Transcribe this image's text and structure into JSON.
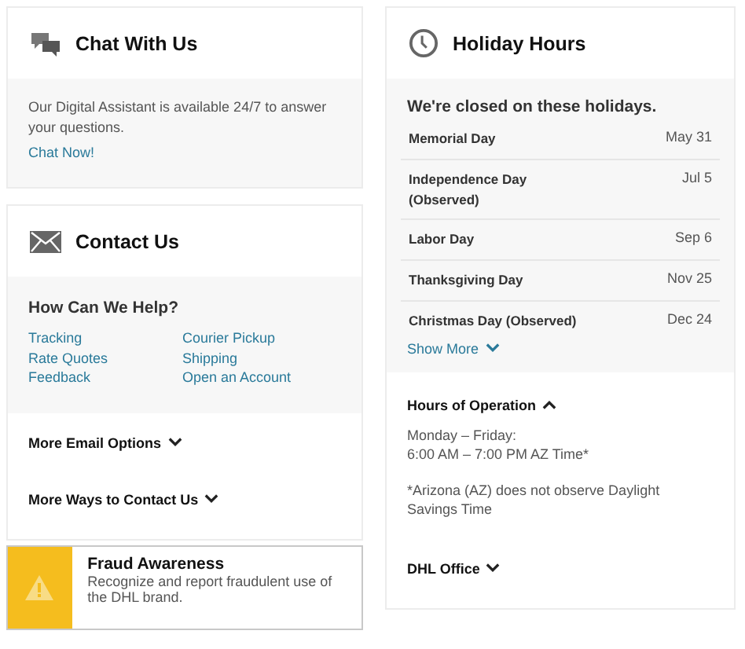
{
  "chat": {
    "title": "Chat With Us",
    "text": "Our Digital Assistant is available 24/7 to answer your questions.",
    "link": "Chat Now!"
  },
  "contact": {
    "title": "Contact Us",
    "subtitle": "How Can We Help?",
    "links": [
      "Tracking",
      "Courier Pickup",
      "Rate Quotes",
      "Shipping",
      "Feedback",
      "Open an Account"
    ],
    "expanders": [
      {
        "label": "More Email Options",
        "expanded": false
      },
      {
        "label": "More Ways to Contact Us",
        "expanded": false
      }
    ]
  },
  "fraud": {
    "title": "Fraud Awareness",
    "text": "Recognize and report fraudulent use of the DHL brand."
  },
  "holiday": {
    "title": "Holiday Hours",
    "subtitle": "We're closed on these holidays.",
    "rows": [
      {
        "name": "Memorial Day",
        "date": "May 31"
      },
      {
        "name": "Independence Day (Observed)",
        "date": "Jul 5"
      },
      {
        "name": "Labor Day",
        "date": "Sep 6"
      },
      {
        "name": "Thanksgiving Day",
        "date": "Nov 25"
      },
      {
        "name": "Christmas Day (Observed)",
        "date": "Dec 24"
      }
    ],
    "show_more": {
      "label": "Show More",
      "expanded": false
    },
    "hours": {
      "label": "Hours of Operation",
      "expanded": true,
      "lines": [
        "Monday – Friday:",
        "6:00 AM – 7:00 PM AZ Time*"
      ],
      "note": "*Arizona (AZ) does not observe Daylight Savings Time"
    },
    "office": {
      "label": "DHL Office",
      "expanded": false
    }
  }
}
